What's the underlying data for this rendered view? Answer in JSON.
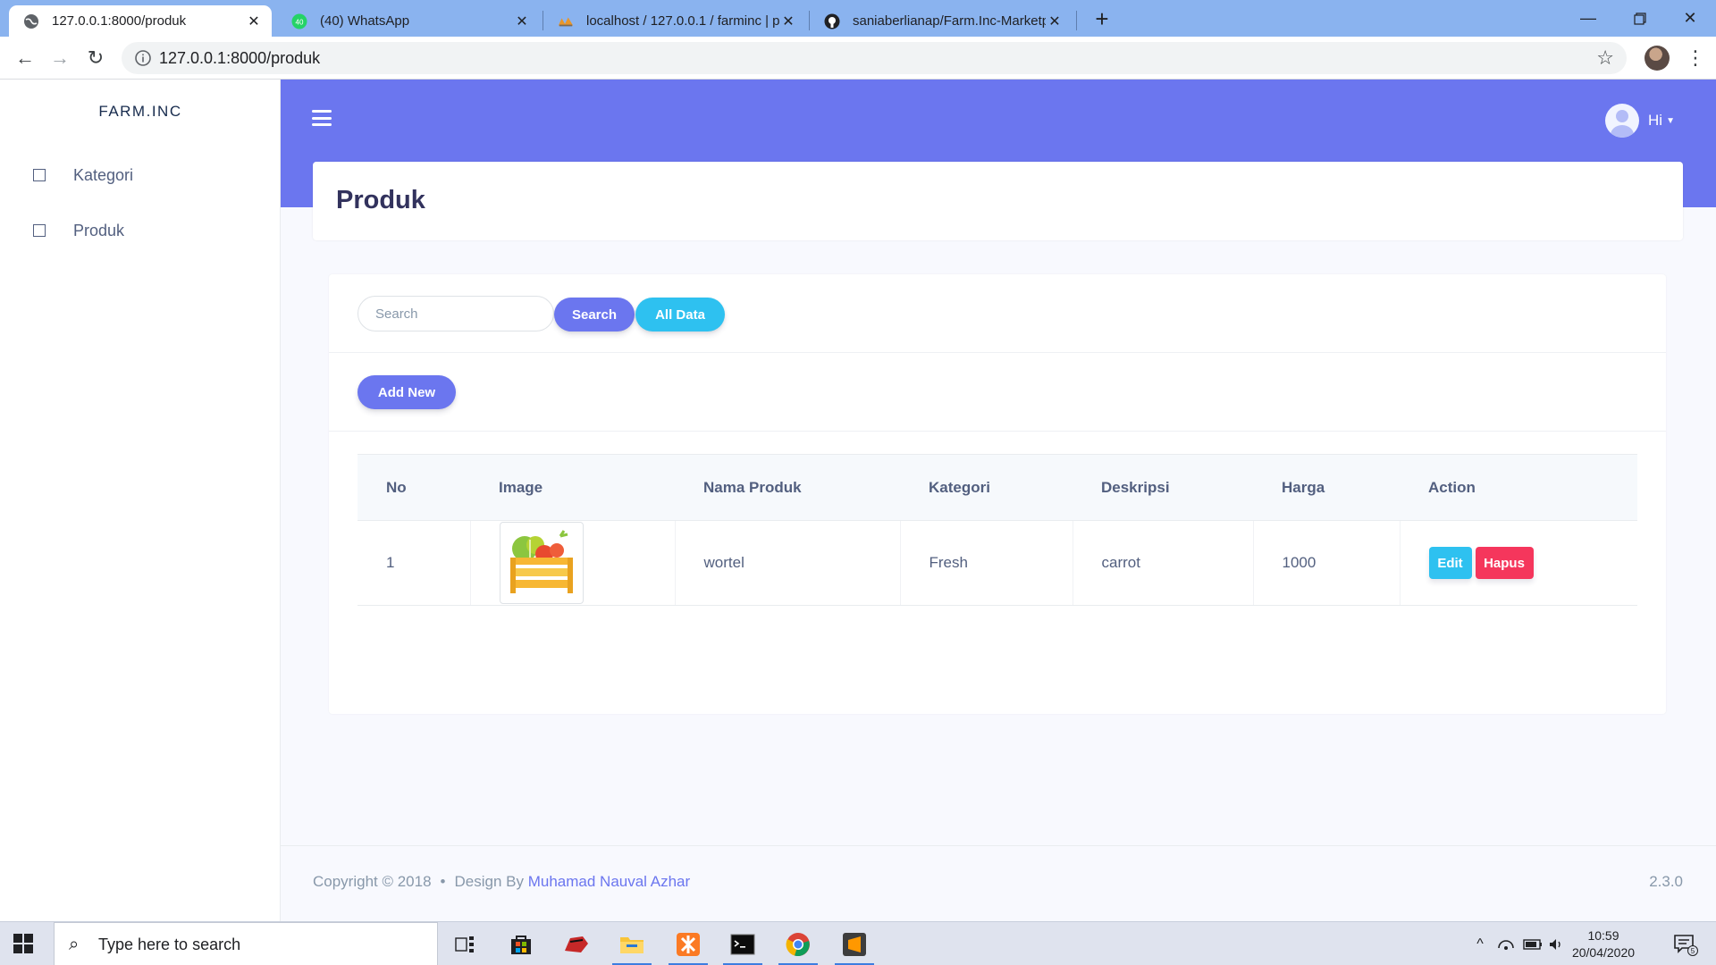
{
  "browser": {
    "tabs": [
      {
        "title": "127.0.0.1:8000/produk",
        "active": true
      },
      {
        "title": "(40) WhatsApp",
        "badge": "40"
      },
      {
        "title": "localhost / 127.0.0.1 / farminc | p"
      },
      {
        "title": "saniaberlianap/Farm.Inc-Marketp"
      }
    ],
    "url": "127.0.0.1:8000/produk"
  },
  "sidebar": {
    "brand": "FARM.INC",
    "items": [
      {
        "label": "Kategori"
      },
      {
        "label": "Produk"
      }
    ]
  },
  "header": {
    "user_label": "Hi"
  },
  "page": {
    "title": "Produk"
  },
  "toolbar": {
    "search_placeholder": "Search",
    "search_button": "Search",
    "all_data_button": "All Data",
    "add_new_button": "Add New"
  },
  "table": {
    "columns": [
      "No",
      "Image",
      "Nama Produk",
      "Kategori",
      "Deskripsi",
      "Harga",
      "Action"
    ],
    "rows": [
      {
        "no": "1",
        "image": "vegetable-crate-icon",
        "nama_produk": "wortel",
        "kategori": "Fresh",
        "deskripsi": "carrot",
        "harga": "1000"
      }
    ],
    "edit_label": "Edit",
    "delete_label": "Hapus"
  },
  "footer": {
    "copyright": "Copyright © 2018",
    "design_by": "Design By",
    "author": "Muhamad Nauval Azhar",
    "version": "2.3.0"
  },
  "taskbar": {
    "search_placeholder": "Type here to search",
    "time": "10:59",
    "date": "20/04/2020",
    "notification_count": "5"
  },
  "colors": {
    "primary": "#6b76ef",
    "info": "#2ec1f0",
    "danger": "#f5365c",
    "chrome_tabstrip": "#8ab3ef"
  }
}
